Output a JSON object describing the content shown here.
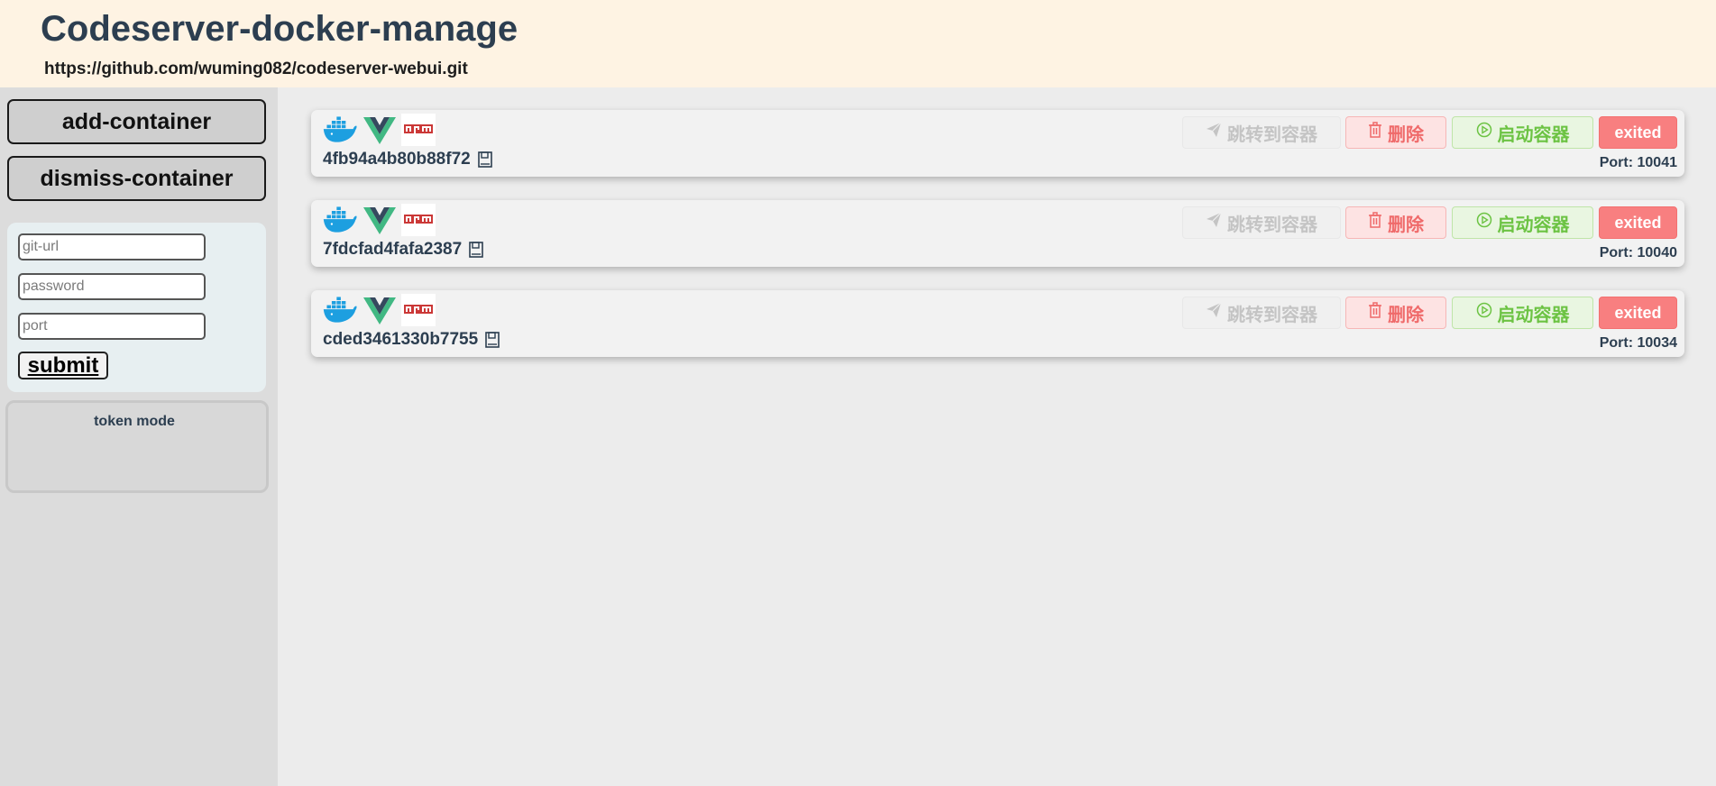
{
  "header": {
    "title": "Codeserver-docker-manage",
    "repo_url": "https://github.com/wuming082/codeserver-webui.git"
  },
  "sidebar": {
    "add_label": "add-container",
    "dismiss_label": "dismiss-container",
    "form": {
      "git_placeholder": "git-url",
      "password_placeholder": "password",
      "port_placeholder": "port",
      "submit_label": "submit"
    },
    "token_label": "token mode"
  },
  "containers": [
    {
      "id": "4fb94a4b80b88f72",
      "port_text": "Port: 10041",
      "jump_label": "跳转到容器",
      "delete_label": "删除",
      "start_label": "启动容器",
      "status": "exited"
    },
    {
      "id": "7fdcfad4fafa2387",
      "port_text": "Port: 10040",
      "jump_label": "跳转到容器",
      "delete_label": "删除",
      "start_label": "启动容器",
      "status": "exited"
    },
    {
      "id": "cded3461330b7755",
      "port_text": "Port: 10034",
      "jump_label": "跳转到容器",
      "delete_label": "删除",
      "start_label": "启动容器",
      "status": "exited"
    }
  ],
  "icons": {
    "docker": "docker-icon",
    "vue": "vue-icon",
    "npm": "npm-icon",
    "send": "send-icon",
    "trash": "trash-icon",
    "play": "play-circle-icon",
    "save": "save-icon"
  },
  "colors": {
    "header_bg": "#fef3e3",
    "sidebar_bg": "#dcdcdc",
    "main_bg": "#ececec",
    "docker_blue": "#1d9fe0",
    "vue_green": "#41b883",
    "vue_dark": "#35495e",
    "npm_red": "#cb3837",
    "delete_red": "#ef6a6a",
    "start_green": "#6cc343",
    "status_red": "#f87f80"
  }
}
